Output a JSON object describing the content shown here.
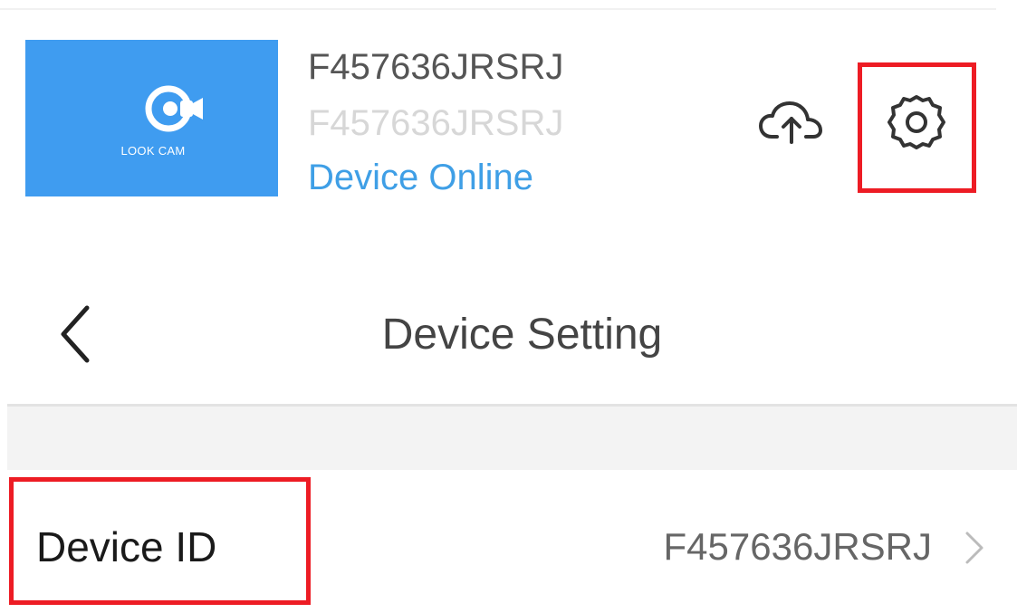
{
  "device_card": {
    "logo_text": "LOOK CAM",
    "name": "F457636JRSRJ",
    "subtitle_id": "F457636JRSRJ",
    "status": "Device Online",
    "thumbnail_color": "#3f9cf0",
    "status_color": "#3f9fe6",
    "icons": {
      "cloud": "cloud-upload-icon",
      "settings": "gear-icon"
    }
  },
  "nav": {
    "title": "Device Setting",
    "back_icon": "chevron-left-icon"
  },
  "settings_rows": [
    {
      "label": "Device ID",
      "value": "F457636JRSRJ",
      "chevron_icon": "chevron-right-icon"
    }
  ],
  "annotations": {
    "highlight_color": "#ed1c24"
  }
}
